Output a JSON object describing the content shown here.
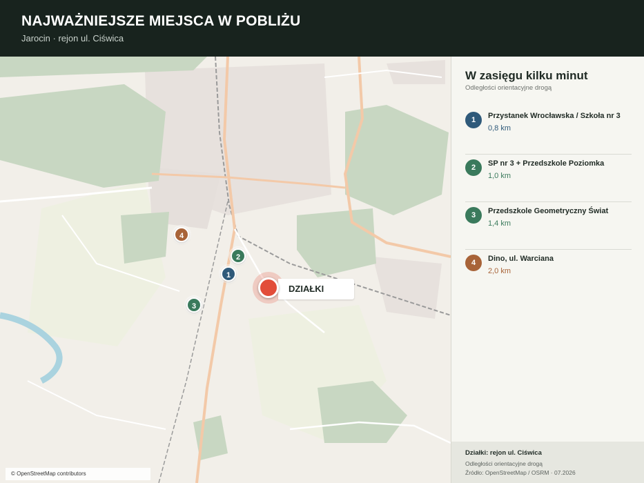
{
  "header": {
    "title": "NAJWAŻNIEJSZE MIEJSCA W POBLIŻU",
    "subtitle": "Jarocin · rejon ul. Ciświca"
  },
  "map": {
    "attribution": "© OpenStreetMap contributors",
    "target_label": "DZIAŁKI",
    "markers": [
      {
        "number": "1",
        "color": "#2f5a7a"
      },
      {
        "number": "2",
        "color": "#3a7a5c"
      },
      {
        "number": "3",
        "color": "#3a7a5c"
      },
      {
        "number": "4",
        "color": "#a86338"
      }
    ]
  },
  "sidebar": {
    "title": "W zasięgu kilku minut",
    "note": "Odległości orientacyjne drogą",
    "items": [
      {
        "number": "1",
        "name": "Przystanek Wrocławska / Szkoła nr 3",
        "distance": "0,8 km",
        "color": "#2f5a7a"
      },
      {
        "number": "2",
        "name": "SP nr 3 + Przedszkole Poziomka",
        "distance": "1,0 km",
        "color": "#3a7a5c"
      },
      {
        "number": "3",
        "name": "Przedszkole Geometryczny Świat",
        "distance": "1,4 km",
        "color": "#3a7a5c"
      },
      {
        "number": "4",
        "name": "Dino, ul. Warciana",
        "distance": "2,0 km",
        "color": "#a86338"
      }
    ],
    "footer": {
      "plots": "Działki: rejon ul. Ciświca",
      "note": "Odległości orientacyjne drogą",
      "source": "Źródło: OpenStreetMap / OSRM · 07.2026"
    }
  },
  "colors": {
    "header_bg": "#18231e",
    "target": "#e24d3a",
    "forest": "#c8d7c2",
    "road": "#f3c9a8"
  }
}
